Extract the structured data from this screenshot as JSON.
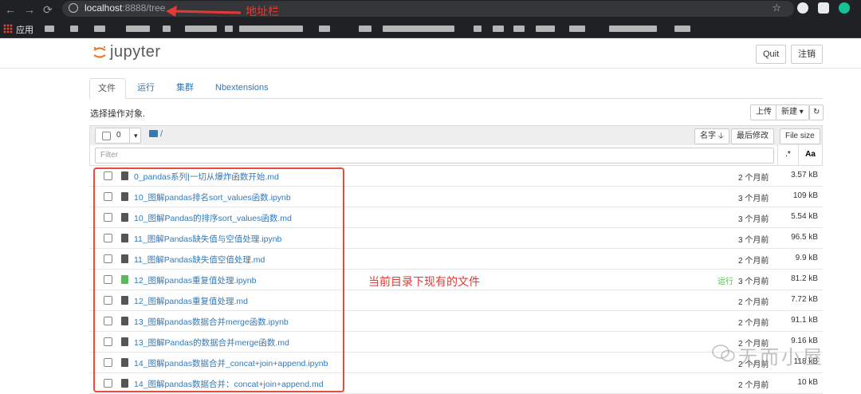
{
  "browser": {
    "back_icon": "arrow-left-icon",
    "url_host": "localhost",
    "url_port_path": ":8888/tree",
    "apps_label": "应用"
  },
  "annotations": {
    "address_bar": "地址栏",
    "current_files": "当前目录下现有的文件",
    "color": "#e53935"
  },
  "header": {
    "logo_text": "jupyter",
    "quit_label": "Quit",
    "logout_label": "注销"
  },
  "tabs": [
    {
      "label": "文件",
      "active": true
    },
    {
      "label": "运行",
      "active": false
    },
    {
      "label": "集群",
      "active": false
    },
    {
      "label": "Nbextensions",
      "active": false
    }
  ],
  "toolbar": {
    "select_hint": "选择操作对象.",
    "upload_label": "上传",
    "new_label": "新建",
    "refresh_icon": "refresh-icon"
  },
  "list_header": {
    "selected_count": "0",
    "path": "/",
    "sort_name": "名字",
    "sort_modified": "最后修改",
    "sort_size": "File size",
    "filter_placeholder": "Filter",
    "regex_label": ".*",
    "case_label": "Aa"
  },
  "files": [
    {
      "name": "0_pandas系列|一切从爆炸函数开始.md",
      "status": "",
      "modified": "2 个月前",
      "size": "3.57 kB"
    },
    {
      "name": "10_图解pandas排名sort_values函数.ipynb",
      "status": "",
      "modified": "3 个月前",
      "size": "109 kB"
    },
    {
      "name": "10_图解Pandas的排序sort_values函数.md",
      "status": "",
      "modified": "3 个月前",
      "size": "5.54 kB"
    },
    {
      "name": "11_图解Pandas缺失值与空值处理.ipynb",
      "status": "",
      "modified": "3 个月前",
      "size": "96.5 kB"
    },
    {
      "name": "11_图解Pandas缺失值空值处理.md",
      "status": "",
      "modified": "2 个月前",
      "size": "9.9 kB"
    },
    {
      "name": "12_图解pandas重复值处理.ipynb",
      "status": "运行",
      "modified": "3 个月前",
      "size": "81.2 kB"
    },
    {
      "name": "12_图解pandas重复值处理.md",
      "status": "",
      "modified": "2 个月前",
      "size": "7.72 kB"
    },
    {
      "name": "13_图解pandas数据合并merge函数.ipynb",
      "status": "",
      "modified": "2 个月前",
      "size": "91.1 kB"
    },
    {
      "name": "13_图解Pandas的数据合并merge函数.md",
      "status": "",
      "modified": "2 个月前",
      "size": "9.16 kB"
    },
    {
      "name": "14_图解pandas数据合并_concat+join+append.ipynb",
      "status": "",
      "modified": "2 个月前",
      "size": "118 kB"
    },
    {
      "name": "14_图解pandas数据合并：concat+join+append.md",
      "status": "",
      "modified": "2 个月前",
      "size": "10 kB"
    }
  ],
  "watermark": "无而小屋"
}
